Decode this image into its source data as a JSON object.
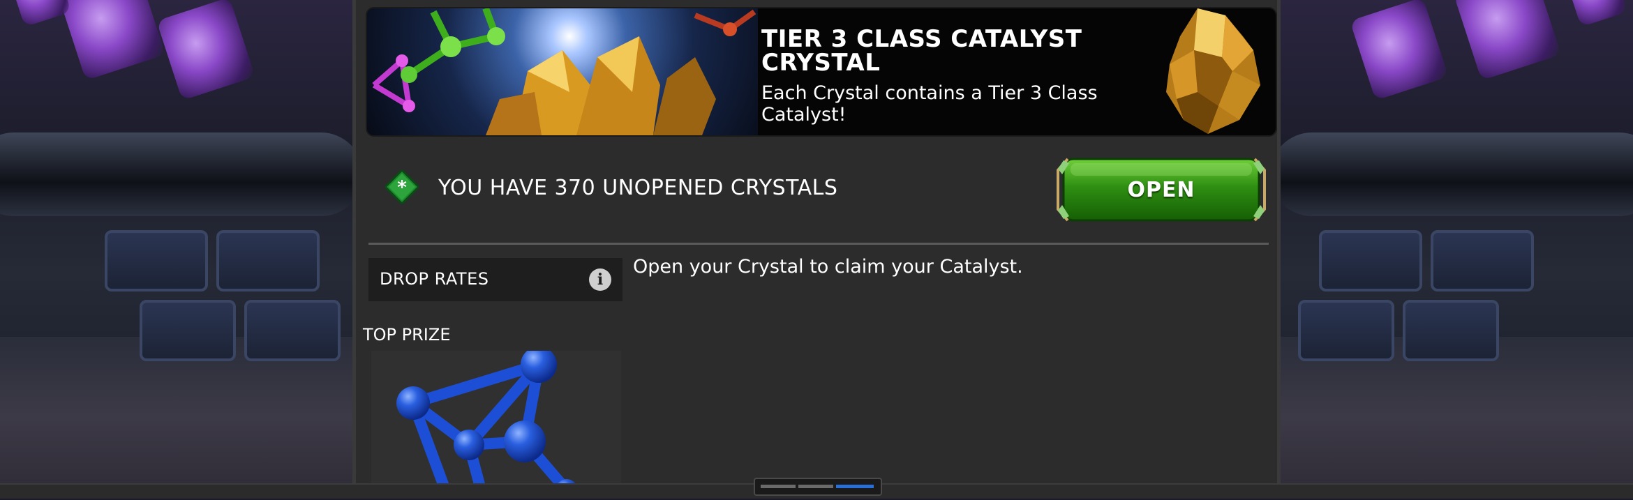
{
  "banner": {
    "title": "TIER 3 CLASS CATALYST CRYSTAL",
    "description": "Each Crystal contains a Tier 3 Class Catalyst!"
  },
  "crystals": {
    "count_text": "YOU HAVE 370 UNOPENED CRYSTALS",
    "count": 370
  },
  "open_button": {
    "label": "OPEN"
  },
  "drop_rates": {
    "label": "DROP RATES",
    "info_icon": "info-icon"
  },
  "description": "Open your Crystal to claim your Catalyst.",
  "top_prize": {
    "label": "TOP PRIZE"
  },
  "pager": {
    "pages": 3,
    "active": 3
  },
  "colors": {
    "panel_bg": "#2c2c2c",
    "button_green": "#2f8f12",
    "gem_green": "#1e8a2e",
    "catalyst_blue": "#1d4fd6",
    "crystal_gold": "#e2a630",
    "active_page": "#2a6fd6"
  }
}
